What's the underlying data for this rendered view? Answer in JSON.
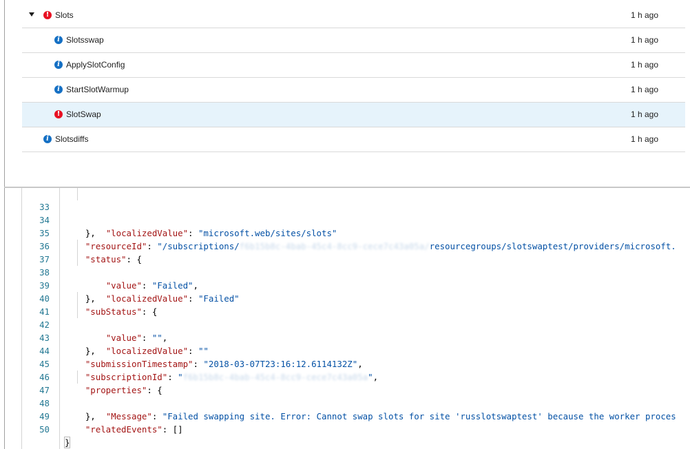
{
  "events": [
    {
      "name": "Slots",
      "status": "error",
      "time": "1 h ago",
      "expanded": true,
      "indent": 0
    },
    {
      "name": "Slotsswap",
      "status": "info",
      "time": "1 h ago",
      "indent": 1
    },
    {
      "name": "ApplySlotConfig",
      "status": "info",
      "time": "1 h ago",
      "indent": 1
    },
    {
      "name": "StartSlotWarmup",
      "status": "info",
      "time": "1 h ago",
      "indent": 1
    },
    {
      "name": "SlotSwap",
      "status": "error",
      "time": "1 h ago",
      "indent": 1,
      "selected": true
    },
    {
      "name": "Slotsdiffs",
      "status": "info",
      "time": "1 h ago",
      "indent": 0
    }
  ],
  "code": {
    "line_numbers": [
      "33",
      "34",
      "35",
      "36",
      "37",
      "38",
      "39",
      "40",
      "41",
      "42",
      "43",
      "44",
      "45",
      "46",
      "47",
      "48",
      "49",
      "50"
    ],
    "lines": {
      "l33_key": "\"localizedValue\"",
      "l33_val": "\"microsoft.web/sites/slots\"",
      "l34": "},",
      "l35_key": "\"resourceId\"",
      "l35_val_a": "\"/subscriptions/",
      "l35_blur": "f6b15b8c-4bab-45c4-8cc9-cece7c43a05a/",
      "l35_val_b": "resourcegroups/slotswaptest/providers/microsoft.",
      "l36_key": "\"status\"",
      "l36_brace": ": {",
      "l37_key": "\"value\"",
      "l37_val": "\"Failed\"",
      "l38_key": "\"localizedValue\"",
      "l38_val": "\"Failed\"",
      "l39": "},",
      "l40_key": "\"subStatus\"",
      "l40_brace": ": {",
      "l41_key": "\"value\"",
      "l41_val": "\"\"",
      "l42_key": "\"localizedValue\"",
      "l42_val": "\"\"",
      "l43": "},",
      "l44_key": "\"submissionTimestamp\"",
      "l44_val": "\"2018-03-07T23:16:12.6114132Z\"",
      "l45_key": "\"subscriptionId\"",
      "l45_val_a": "\"",
      "l45_blur": "f6b15b8c-4bab-45c4-8cc9-cece7c43a05a",
      "l45_val_b": "\"",
      "l46_key": "\"properties\"",
      "l46_brace": ": {",
      "l47_key": "\"Message\"",
      "l47_val": "\"Failed swapping site. Error: Cannot swap slots for site 'russlotswaptest' because the worker proces",
      "l48": "},",
      "l49_key": "\"relatedEvents\"",
      "l49_val": "[]",
      "l50": "}"
    }
  },
  "colors": {
    "error": "#e81123",
    "info": "#1570c4",
    "selected_row": "#e6f3fb",
    "json_key": "#a31515",
    "json_string": "#0451a5",
    "line_number": "#237893"
  }
}
